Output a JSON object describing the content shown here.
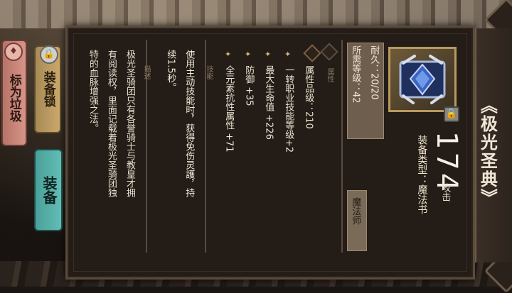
{
  "item": {
    "title": "《极光圣典》",
    "attack_value": "174",
    "attack_label": "攻击",
    "equip_type": "装备类型：魔法书",
    "class": "魔法师",
    "required_level": "所需等级：42",
    "durability": "耐久：20/20",
    "icon": "aurora-tome-icon"
  },
  "sections": {
    "properties": {
      "label": "属性",
      "header": "属性品级：210",
      "stats": [
        "一转职业技能等级+2",
        "最大生命值 +226",
        "防御 +35",
        "全元素抗性属性 +71"
      ]
    },
    "skill": {
      "label": "技能",
      "lines": [
        "使用主动技能时，获得免伤灵護，持",
        "续1.5秒。"
      ]
    },
    "description": {
      "label": "描述",
      "lines": [
        "极光圣骑团只有各誉骑士与教皇才拥",
        "有阅读权，里面记载着极光圣骑团独",
        "特的血脉增强之法。"
      ]
    }
  },
  "buttons": {
    "trash": "标为垃圾",
    "lock": "装备锁",
    "equip": "装备"
  },
  "colors": {
    "panel_bg": "#231c17",
    "equip_button": "#4aa19a",
    "lock_button": "#c9a86b",
    "trash_button": "#d79588",
    "bullet": "#d9b070"
  }
}
